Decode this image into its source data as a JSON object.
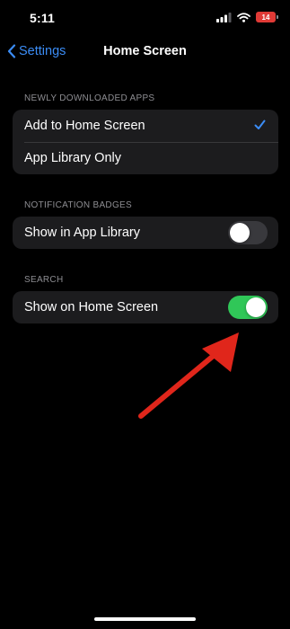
{
  "status_bar": {
    "time": "5:11",
    "battery_level": "14",
    "battery_color": "#e03a36",
    "signal_icon": "cellular-signal-icon",
    "wifi_icon": "wifi-icon"
  },
  "nav": {
    "back_label": "Settings",
    "title": "Home Screen"
  },
  "sections": [
    {
      "header": "NEWLY DOWNLOADED APPS",
      "rows": [
        {
          "label": "Add to Home Screen",
          "selected": true
        },
        {
          "label": "App Library Only",
          "selected": false
        }
      ]
    },
    {
      "header": "NOTIFICATION BADGES",
      "rows": [
        {
          "label": "Show in App Library",
          "toggle": "off"
        }
      ]
    },
    {
      "header": "SEARCH",
      "rows": [
        {
          "label": "Show on Home Screen",
          "toggle": "on"
        }
      ]
    }
  ],
  "colors": {
    "accent": "#3b8cf5",
    "toggle_on": "#30c758",
    "toggle_off": "#39393d",
    "cell_background": "#1c1c1e",
    "annotation_arrow": "#e0261b"
  }
}
